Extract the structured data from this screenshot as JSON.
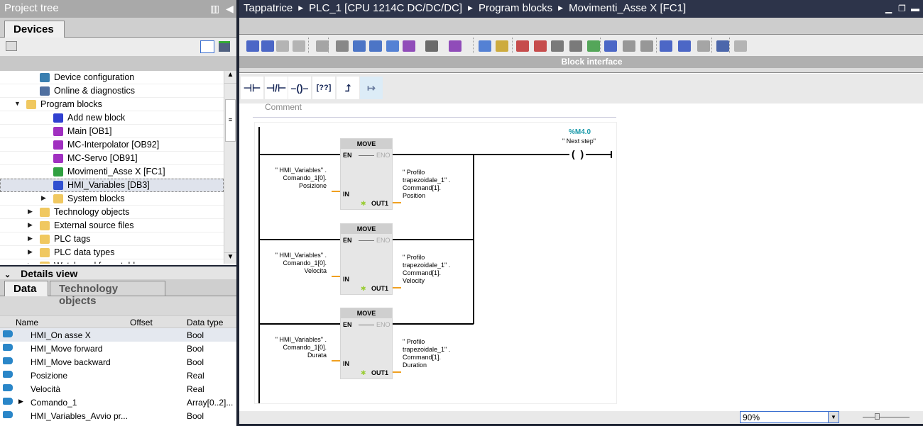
{
  "project_tree": {
    "title": "Project tree",
    "tab": "Devices",
    "items": [
      {
        "label": "Device configuration",
        "icon": "device-config-icon",
        "indent": 3,
        "expander": ""
      },
      {
        "label": "Online & diagnostics",
        "icon": "diagnostics-icon",
        "indent": 3,
        "expander": ""
      },
      {
        "label": "Program blocks",
        "icon": "folder-icon",
        "indent": 2,
        "expander": "▼"
      },
      {
        "label": "Add new block",
        "icon": "add-block-icon",
        "indent": 4,
        "expander": ""
      },
      {
        "label": "Main [OB1]",
        "icon": "ob-icon",
        "indent": 4,
        "expander": ""
      },
      {
        "label": "MC-Interpolator [OB92]",
        "icon": "ob-icon",
        "indent": 4,
        "expander": ""
      },
      {
        "label": "MC-Servo [OB91]",
        "icon": "ob-icon",
        "indent": 4,
        "expander": ""
      },
      {
        "label": "Movimenti_Asse X [FC1]",
        "icon": "fc-icon",
        "indent": 4,
        "expander": ""
      },
      {
        "label": "HMI_Variables [DB3]",
        "icon": "db-icon",
        "indent": 4,
        "expander": "",
        "selected": true
      },
      {
        "label": "System blocks",
        "icon": "folder-icon",
        "indent": 4,
        "expander": "▶"
      },
      {
        "label": "Technology objects",
        "icon": "folder-icon",
        "indent": 3,
        "expander": "▶"
      },
      {
        "label": "External source files",
        "icon": "folder-icon",
        "indent": 3,
        "expander": "▶"
      },
      {
        "label": "PLC tags",
        "icon": "folder-icon",
        "indent": 3,
        "expander": "▶"
      },
      {
        "label": "PLC data types",
        "icon": "folder-icon",
        "indent": 3,
        "expander": "▶"
      },
      {
        "label": "Watch and force tables",
        "icon": "folder-icon",
        "indent": 3,
        "expander": "▶"
      }
    ]
  },
  "details": {
    "title": "Details view",
    "tabs": [
      "Data",
      "Technology objects"
    ],
    "columns": [
      "Name",
      "Offset",
      "Data type"
    ],
    "rows": [
      {
        "name": "HMI_On asse X",
        "offset": "",
        "type": "Bool",
        "expander": ""
      },
      {
        "name": "HMI_Move forward",
        "offset": "",
        "type": "Bool",
        "expander": ""
      },
      {
        "name": "HMI_Move backward",
        "offset": "",
        "type": "Bool",
        "expander": ""
      },
      {
        "name": "Posizione",
        "offset": "",
        "type": "Real",
        "expander": ""
      },
      {
        "name": "Velocità",
        "offset": "",
        "type": "Real",
        "expander": ""
      },
      {
        "name": "Comando_1",
        "offset": "",
        "type": "Array[0..2]...",
        "expander": "▶"
      },
      {
        "name": "HMI_Variables_Avvio pr...",
        "offset": "",
        "type": "Bool",
        "expander": ""
      }
    ]
  },
  "editor": {
    "breadcrumb": [
      "Tappatrice",
      "PLC_1 [CPU 1214C DC/DC/DC]",
      "Program blocks",
      "Movimenti_Asse X [FC1]"
    ],
    "block_interface": "Block interface",
    "comment_placeholder": "Comment",
    "coil": {
      "address": "%M4.0",
      "name": "\" Next step\""
    },
    "boxes": [
      {
        "title": "MOVE",
        "en": "EN",
        "eno": "ENO",
        "in": "IN",
        "out": "OUT1",
        "in_op": [
          "\" HMI_Variables\" .",
          "Comando_1[0].",
          "Posizione"
        ],
        "out_op": [
          "\" Profilo",
          "trapezoidale_1\" .",
          "Command[1].",
          "Position"
        ]
      },
      {
        "title": "MOVE",
        "en": "EN",
        "eno": "ENO",
        "in": "IN",
        "out": "OUT1",
        "in_op": [
          "\" HMI_Variables\" .",
          "Comando_1[0].",
          "Velocita"
        ],
        "out_op": [
          "\" Profilo",
          "trapezoidale_1\" .",
          "Command[1].",
          "Velocity"
        ]
      },
      {
        "title": "MOVE",
        "en": "EN",
        "eno": "ENO",
        "in": "IN",
        "out": "OUT1",
        "in_op": [
          "\" HMI_Variables\" .",
          "Comando_1[0].",
          "Durata"
        ],
        "out_op": [
          "\" Profilo",
          "trapezoidale_1\" .",
          "Command[1].",
          "Duration"
        ]
      }
    ],
    "zoom_value": "90%",
    "ladder_tools": [
      "normally-open-contact",
      "normally-closed-contact",
      "coil",
      "empty-box",
      "open-branch",
      "close-branch"
    ]
  },
  "colors": {
    "accent": "#2d344a",
    "wire_orange": "#f0a020",
    "address_teal": "#1a9aaa"
  }
}
